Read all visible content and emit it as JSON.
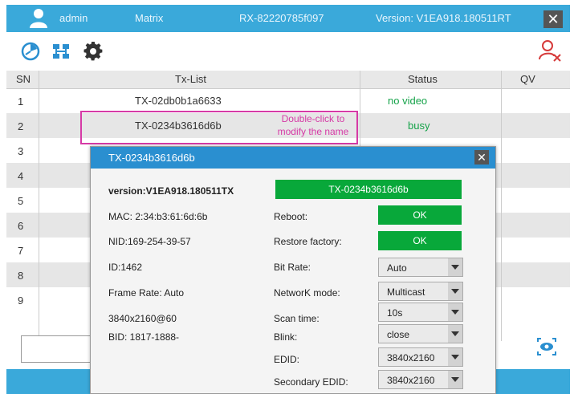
{
  "header": {
    "user": "admin",
    "product": "Matrix",
    "rx_id": "RX-82220785f097",
    "version": "Version: V1EA918.180511RT",
    "close": "✕"
  },
  "table": {
    "headers": [
      "SN",
      "Tx-List",
      "Status",
      "QV"
    ],
    "rows": [
      {
        "sn": "1",
        "tx": "TX-02db0b1a6633",
        "status": "no video"
      },
      {
        "sn": "2",
        "tx": "TX-0234b3616d6b",
        "status": "busy"
      },
      {
        "sn": "3",
        "tx": "",
        "status": ""
      },
      {
        "sn": "4",
        "tx": "",
        "status": ""
      },
      {
        "sn": "5",
        "tx": "",
        "status": ""
      },
      {
        "sn": "6",
        "tx": "",
        "status": ""
      },
      {
        "sn": "7",
        "tx": "",
        "status": ""
      },
      {
        "sn": "8",
        "tx": "",
        "status": ""
      },
      {
        "sn": "9",
        "tx": "",
        "status": ""
      }
    ]
  },
  "callout": {
    "line1": "Double-click to",
    "line2": "modify the name"
  },
  "dialog": {
    "title": "TX-0234b3616d6b",
    "close": "✕",
    "version": "version:V1EA918.180511TX",
    "name_value": "TX-0234b3616d6b",
    "mac": "MAC: 2:34:b3:61:6d:6b",
    "nid": "NID:169-254-39-57",
    "id": "ID:1462",
    "frame_rate": "Frame Rate: Auto",
    "resolution": "3840x2160@60",
    "bid": "BID: 1817-1888-",
    "reboot_label": "Reboot:",
    "reboot_btn": "OK",
    "restore_label": "Restore factory:",
    "restore_btn": "OK",
    "bitrate_label": "Bit Rate:",
    "bitrate_value": "Auto",
    "network_label": "NetworK mode:",
    "network_value": "Multicast",
    "scan_label": "Scan time:",
    "scan_value": "10s",
    "blink_label": "Blink:",
    "blink_value": "close",
    "edid_label": "EDID:",
    "edid_value": "3840x2160",
    "sec_edid_label": "Secondary EDID:",
    "sec_edid_value": "3840x2160"
  },
  "colors": {
    "topbar": "#3aa9da",
    "dialog_title": "#2a8fd0",
    "green": "#08a83a",
    "pink": "#d63aa6",
    "status_green": "#16a34a"
  }
}
